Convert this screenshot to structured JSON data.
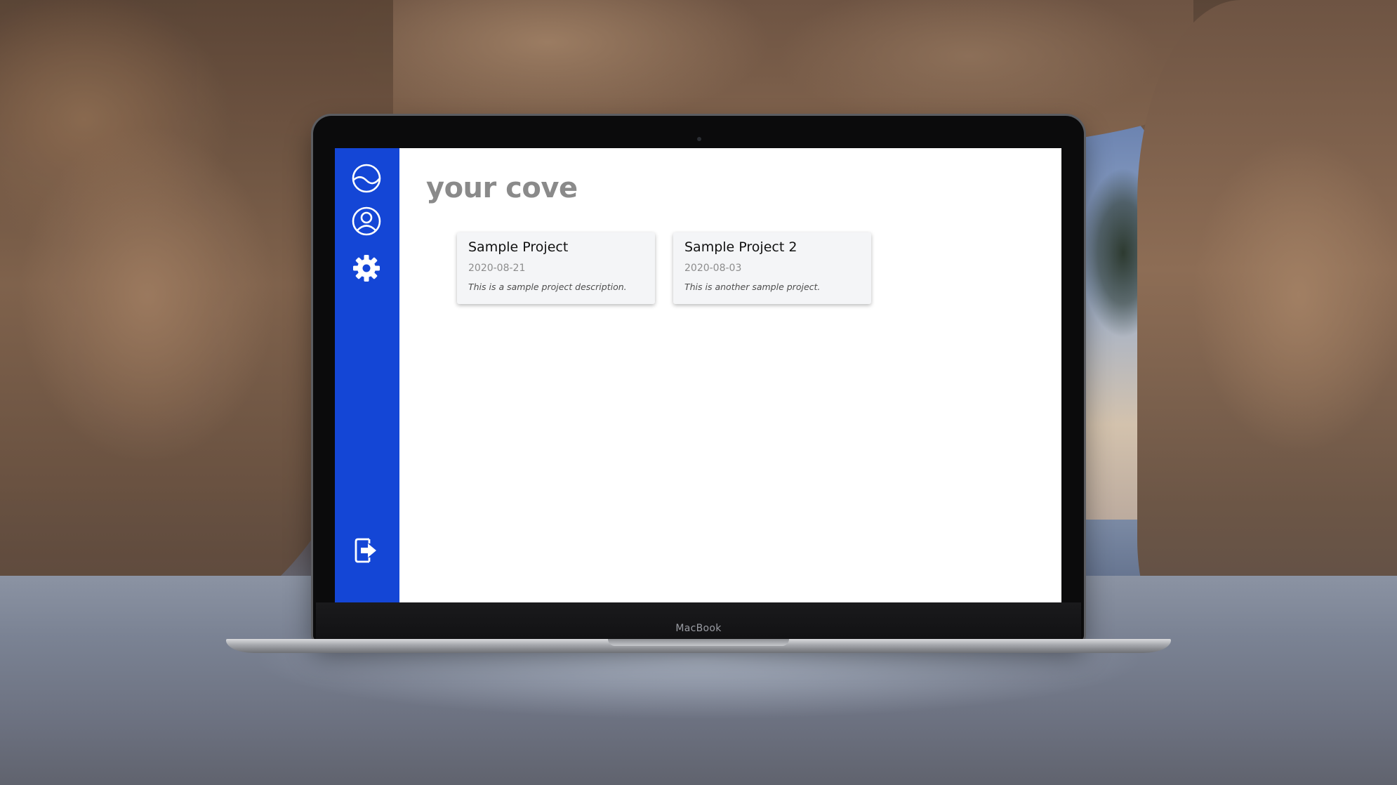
{
  "device": {
    "brand_label": "MacBook"
  },
  "sidebar": {
    "background_color": "#1446d6",
    "items": [
      {
        "icon": "cove-logo-icon",
        "role": "home"
      },
      {
        "icon": "user-profile-icon",
        "role": "profile"
      },
      {
        "icon": "gear-icon",
        "role": "settings"
      }
    ],
    "footer_item": {
      "icon": "logout-icon",
      "role": "logout"
    }
  },
  "main": {
    "title": "your cove",
    "projects": [
      {
        "name": "Sample Project",
        "date": "2020-08-21",
        "description": "This is a sample project description."
      },
      {
        "name": "Sample Project 2",
        "date": "2020-08-03",
        "description": "This is another sample project."
      }
    ]
  }
}
